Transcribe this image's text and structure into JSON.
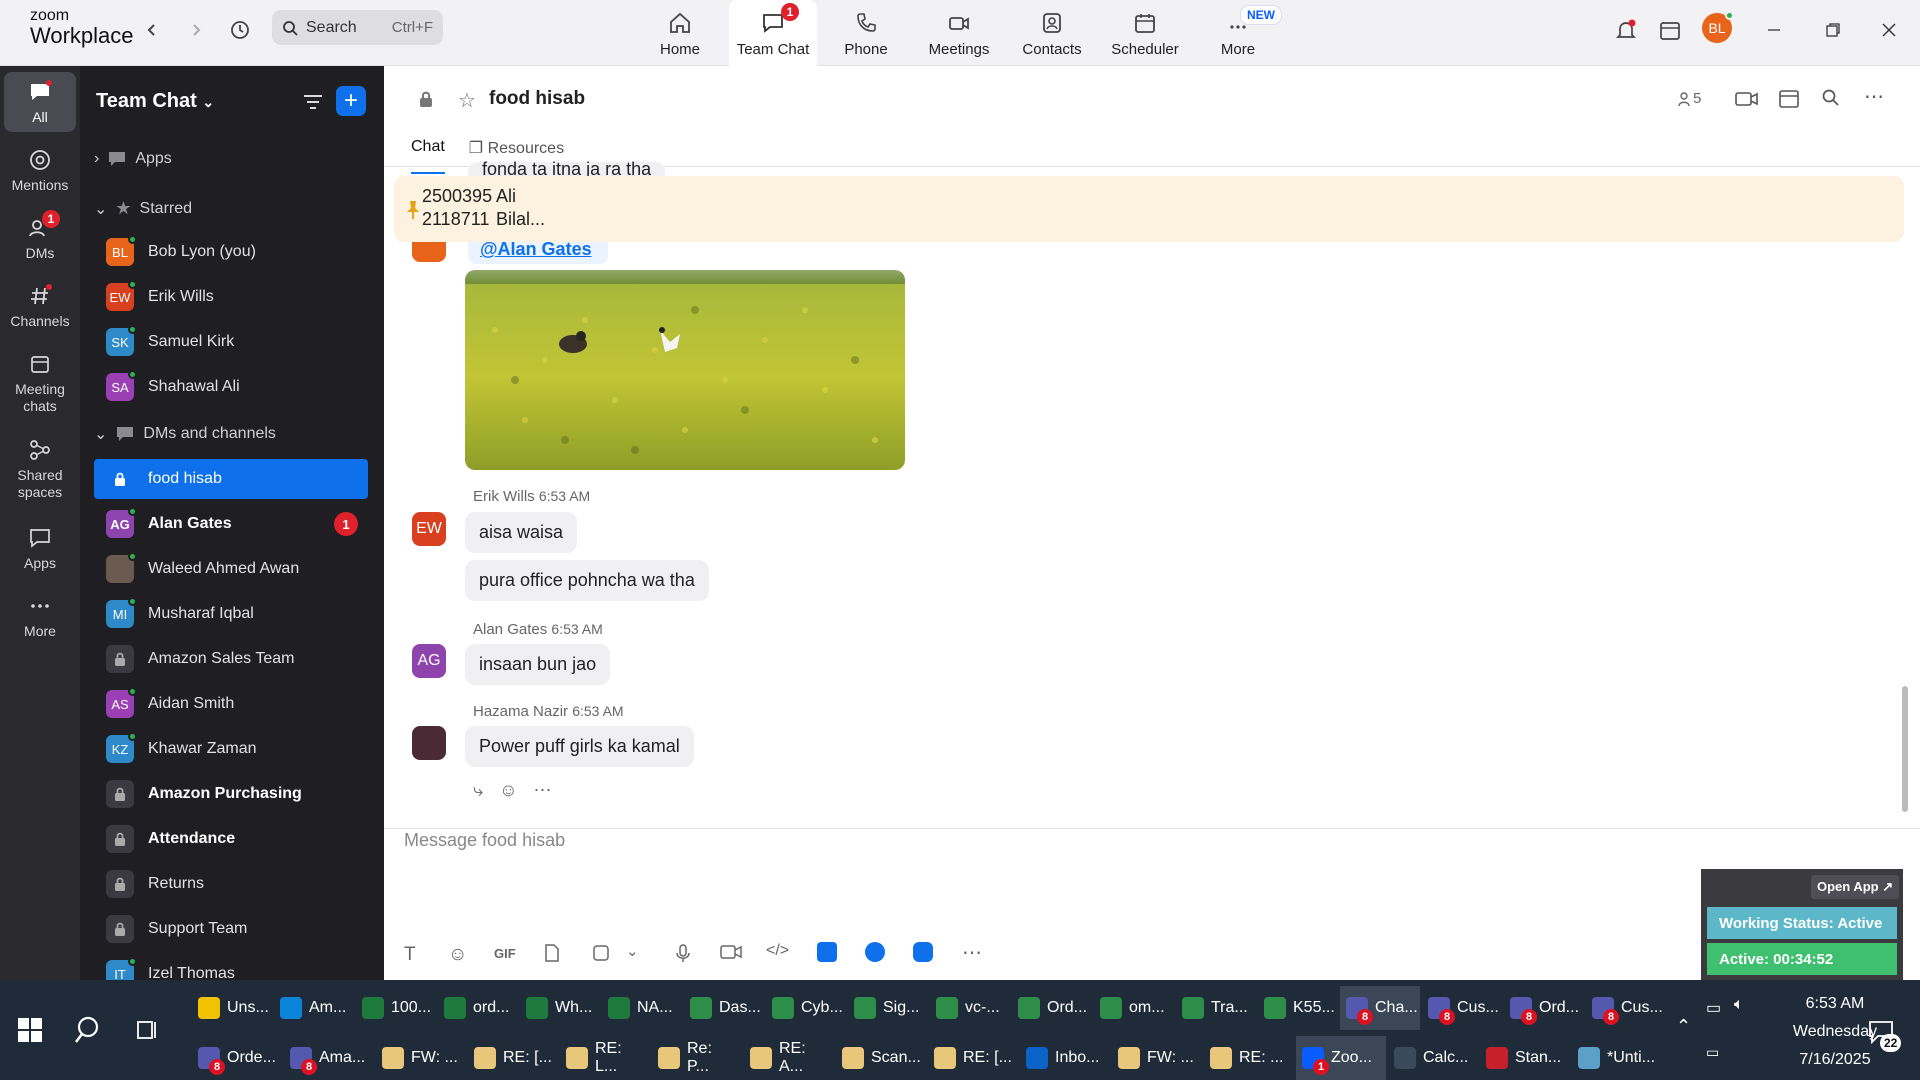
{
  "app": {
    "logo_line1": "zoom",
    "logo_line2": "Workplace"
  },
  "topbar": {
    "search_label": "Search",
    "search_shortcut": "Ctrl+F",
    "nav": [
      {
        "label": "Home",
        "icon": "home-icon"
      },
      {
        "label": "Team Chat",
        "icon": "chat-icon",
        "badge": "1"
      },
      {
        "label": "Phone",
        "icon": "phone-icon"
      },
      {
        "label": "Meetings",
        "icon": "video-icon"
      },
      {
        "label": "Contacts",
        "icon": "contacts-icon"
      },
      {
        "label": "Scheduler",
        "icon": "calendar-icon"
      },
      {
        "label": "More",
        "icon": "more-icon",
        "new_badge": "NEW"
      }
    ],
    "user_initials": "BL"
  },
  "rail": {
    "items": [
      {
        "label": "All"
      },
      {
        "label": "Mentions"
      },
      {
        "label": "DMs",
        "badge": "1"
      },
      {
        "label": "Channels"
      },
      {
        "label": "Meeting chats"
      },
      {
        "label": "Shared spaces"
      },
      {
        "label": "Apps"
      },
      {
        "label": "More"
      }
    ]
  },
  "sidebar": {
    "title": "Team Chat",
    "apps_label": "Apps",
    "starred_label": "Starred",
    "starred": [
      {
        "initials": "BL",
        "name": "Bob Lyon (you)",
        "color": "#e8641b"
      },
      {
        "initials": "EW",
        "name": "Erik Wills",
        "color": "#d9401f"
      },
      {
        "initials": "SK",
        "name": "Samuel Kirk",
        "color": "#2d89c8"
      },
      {
        "initials": "SA",
        "name": "Shahawal Ali",
        "color": "#9b3fb5"
      }
    ],
    "dms_label": "DMs and channels",
    "dms": [
      {
        "name": "food hisab",
        "type": "channel",
        "selected": true
      },
      {
        "initials": "AG",
        "name": "Alan Gates",
        "color": "#8e44ad",
        "bold": true,
        "badge": "1"
      },
      {
        "initials": "",
        "name": "Waleed Ahmed Awan",
        "color": "#6a5a50"
      },
      {
        "initials": "MI",
        "name": "Musharaf Iqbal",
        "color": "#2d89c8"
      },
      {
        "name": "Amazon Sales Team",
        "type": "channel"
      },
      {
        "initials": "AS",
        "name": "Aidan Smith",
        "color": "#9b3fb5"
      },
      {
        "initials": "KZ",
        "name": "Khawar Zaman",
        "color": "#2d89c8"
      },
      {
        "name": "Amazon Purchasing",
        "type": "channel",
        "bold": true
      },
      {
        "name": "Attendance",
        "type": "channel",
        "bold": true
      },
      {
        "name": "Returns",
        "type": "channel"
      },
      {
        "name": "Support Team",
        "type": "channel"
      },
      {
        "initials": "IT",
        "name": "Izel Thomas",
        "color": "#2d89c8"
      }
    ]
  },
  "chat": {
    "channel_name": "food hisab",
    "member_count": "5",
    "tabs": [
      "Chat",
      "Resources"
    ],
    "partial_text": "fonda ta itna ja ra tha",
    "pinned": {
      "line1_num": "2500395",
      "line1_name": "Ali",
      "line2_num": "2118711",
      "line2_name": "Bilal..."
    },
    "mention": "@Alan Gates",
    "messages": [
      {
        "author": "Erik Wills",
        "time": "6:53 AM",
        "initials": "EW",
        "color": "#d9401f",
        "texts": [
          "aisa waisa",
          "pura office pohncha wa tha"
        ]
      },
      {
        "author": "Alan Gates",
        "time": "6:53 AM",
        "initials": "AG",
        "color": "#8e44ad",
        "texts": [
          "insaan bun jao"
        ]
      },
      {
        "author": "Hazama Nazir",
        "time": "6:53 AM",
        "initials": "",
        "color": "#4a2a35",
        "texts": [
          "Power puff girls ka kamal"
        ]
      }
    ],
    "composer_placeholder": "Message food hisab",
    "toolbar_gif": "GIF"
  },
  "widget": {
    "open_app": "Open App ↗",
    "status": "Working Status: Active",
    "active": "Active: 00:34:52"
  },
  "taskbar": {
    "row1": [
      {
        "label": "Uns...",
        "color": "#f2c200"
      },
      {
        "label": "Am...",
        "color": "#0a84d8"
      },
      {
        "label": "100...",
        "color": "#1d7a3c"
      },
      {
        "label": "ord...",
        "color": "#1d7a3c"
      },
      {
        "label": "Wh...",
        "color": "#1d7a3c"
      },
      {
        "label": "NA...",
        "color": "#1d7a3c"
      },
      {
        "label": "Das...",
        "color": "#2f8d4a"
      },
      {
        "label": "Cyb...",
        "color": "#2f8d4a"
      },
      {
        "label": "Sig...",
        "color": "#2f8d4a"
      },
      {
        "label": "vc-...",
        "color": "#2f8d4a"
      },
      {
        "label": "Ord...",
        "color": "#2f8d4a"
      },
      {
        "label": "om...",
        "color": "#2f8d4a"
      },
      {
        "label": "Tra...",
        "color": "#2f8d4a"
      },
      {
        "label": "K55...",
        "color": "#2f8d4a"
      },
      {
        "label": "Cha...",
        "color": "#5558af",
        "badge": "8",
        "active": true
      },
      {
        "label": "Cus...",
        "color": "#5558af",
        "badge": "8"
      },
      {
        "label": "Ord...",
        "color": "#5558af",
        "badge": "8"
      },
      {
        "label": "Cus...",
        "color": "#5558af",
        "badge": "8"
      }
    ],
    "row2": [
      {
        "label": "Orde...",
        "color": "#5558af",
        "badge": "8"
      },
      {
        "label": "Ama...",
        "color": "#5558af",
        "badge": "8"
      },
      {
        "label": "FW: ...",
        "color": "#e8c77a"
      },
      {
        "label": "RE: [...",
        "color": "#e8c77a"
      },
      {
        "label": "RE: L...",
        "color": "#e8c77a"
      },
      {
        "label": "Re: P...",
        "color": "#e8c77a"
      },
      {
        "label": "RE: A...",
        "color": "#e8c77a"
      },
      {
        "label": "Scan...",
        "color": "#e8c77a"
      },
      {
        "label": "RE: [...",
        "color": "#e8c77a"
      },
      {
        "label": "Inbo...",
        "color": "#0a64c8"
      },
      {
        "label": "FW: ...",
        "color": "#e8c77a"
      },
      {
        "label": "RE: ...",
        "color": "#e8c77a"
      },
      {
        "label": "Zoo...",
        "color": "#0b5cff",
        "badge": "1",
        "active": true
      },
      {
        "label": "Calc...",
        "color": "#3a4a5a"
      },
      {
        "label": "Stan...",
        "color": "#c8202a"
      },
      {
        "label": "*Unti...",
        "color": "#5aa0c8"
      }
    ],
    "time": "6:53 AM",
    "day": "Wednesday",
    "date": "7/16/2025",
    "notif_count": "22"
  }
}
